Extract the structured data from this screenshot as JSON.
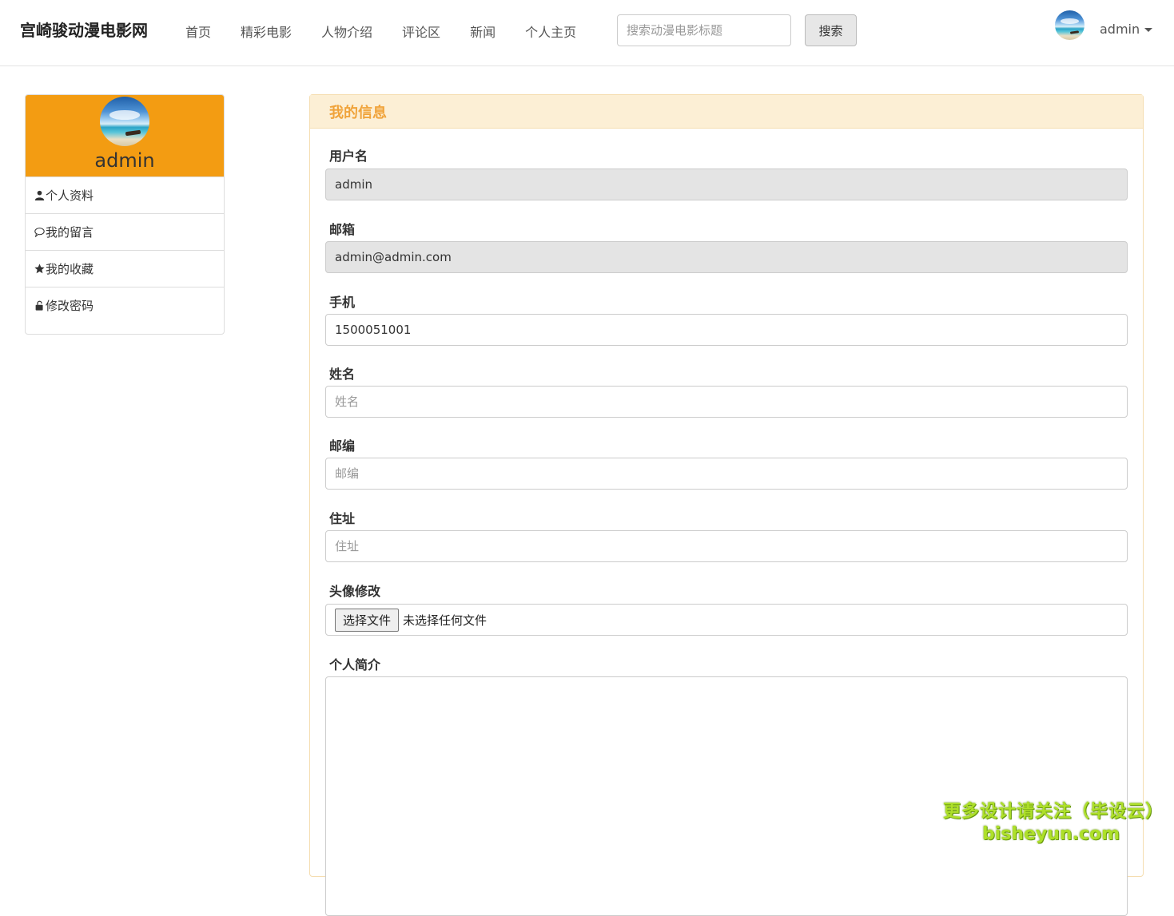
{
  "navbar": {
    "brand": "宫崎骏动漫电影网",
    "links": [
      "首页",
      "精彩电影",
      "人物介绍",
      "评论区",
      "新闻",
      "个人主页"
    ],
    "search_placeholder": "搜索动漫电影标题",
    "search_button": "搜索",
    "user_name": "admin"
  },
  "sidebar": {
    "user_name": "admin",
    "accent_color": "#f39c12",
    "items": [
      {
        "label": "个人资料",
        "icon": "user-icon"
      },
      {
        "label": "我的留言",
        "icon": "comment-icon"
      },
      {
        "label": "我的收藏",
        "icon": "star-icon"
      },
      {
        "label": "修改密码",
        "icon": "unlock-icon"
      }
    ]
  },
  "panel": {
    "title": "我的信息",
    "fields": {
      "username": {
        "label": "用户名",
        "value": "admin"
      },
      "email": {
        "label": "邮箱",
        "value": "admin@admin.com"
      },
      "phone": {
        "label": "手机",
        "value": "1500051001"
      },
      "name": {
        "label": "姓名",
        "placeholder": "姓名"
      },
      "zipcode": {
        "label": "邮编",
        "placeholder": "邮编"
      },
      "address": {
        "label": "住址",
        "placeholder": "住址"
      },
      "avatar": {
        "label": "头像修改",
        "button": "选择文件",
        "status": "未选择任何文件"
      },
      "bio": {
        "label": "个人简介"
      }
    }
  },
  "watermark": {
    "line1": "更多设计请关注（毕设云）",
    "line2": "bisheyun.com"
  }
}
